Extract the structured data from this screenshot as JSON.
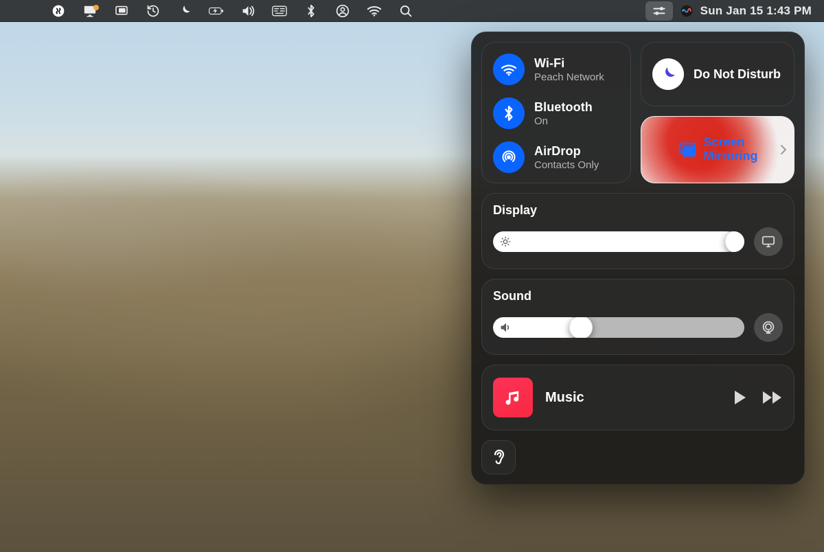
{
  "menubar": {
    "datetime": "Sun Jan 15  1:43 PM"
  },
  "control_center": {
    "wifi": {
      "title": "Wi-Fi",
      "subtitle": "Peach Network"
    },
    "bluetooth": {
      "title": "Bluetooth",
      "subtitle": "On"
    },
    "airdrop": {
      "title": "AirDrop",
      "subtitle": "Contacts Only"
    },
    "dnd": {
      "title": "Do Not Disturb"
    },
    "screen_mirroring": {
      "title": "Screen Mirroring"
    },
    "display": {
      "title": "Display",
      "brightness_pct": 97
    },
    "sound": {
      "title": "Sound",
      "volume_pct": 35
    },
    "media": {
      "title": "Music"
    }
  }
}
